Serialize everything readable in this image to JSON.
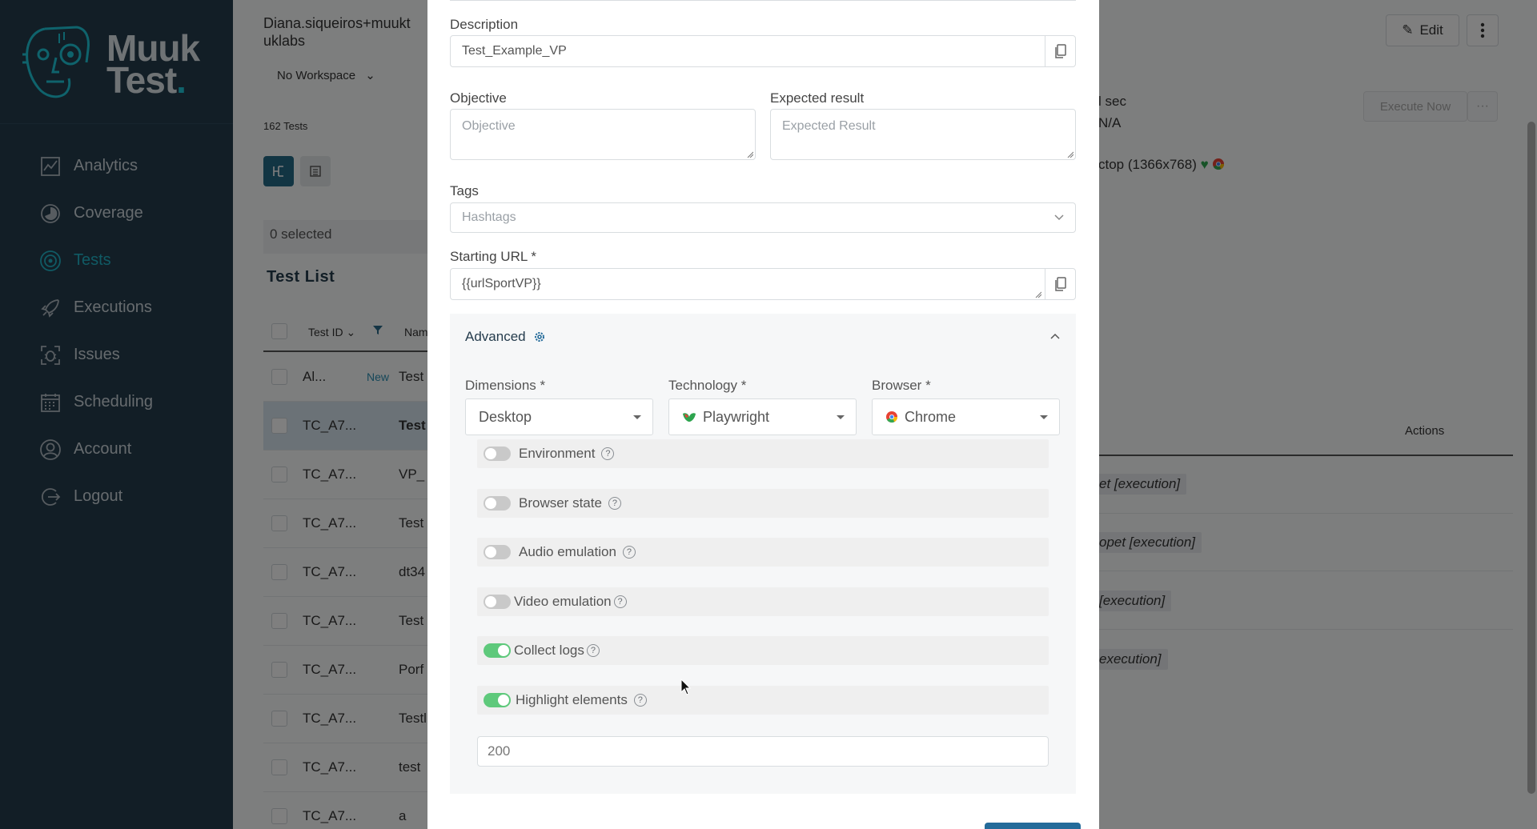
{
  "sidebar": {
    "logo": {
      "line1": "Muuk",
      "line2": "Test",
      "dot": "."
    },
    "items": [
      {
        "label": "Analytics",
        "icon": "analytics-icon",
        "active": false
      },
      {
        "label": "Coverage",
        "icon": "coverage-icon",
        "active": false
      },
      {
        "label": "Tests",
        "icon": "tests-icon",
        "active": true
      },
      {
        "label": "Executions",
        "icon": "rocket-icon",
        "active": false
      },
      {
        "label": "Issues",
        "icon": "bug-icon",
        "active": false
      },
      {
        "label": "Scheduling",
        "icon": "calendar-icon",
        "active": false
      },
      {
        "label": "Account",
        "icon": "user-icon",
        "active": false
      },
      {
        "label": "Logout",
        "icon": "logout-icon",
        "active": false
      }
    ]
  },
  "main": {
    "user_line1": "Diana.siqueiros+muukt",
    "user_line2": "uklabs",
    "workspace": "No Workspace",
    "tests_count": "162",
    "tests_label": "Tests",
    "selected": "0 selected",
    "list_title": "Test List",
    "col_test_id": "Test ID",
    "col_name": "Nam",
    "rows": [
      {
        "id": "Al...",
        "badge": "New",
        "name": "Test"
      },
      {
        "id": "TC_A7...",
        "name": "Test"
      },
      {
        "id": "TC_A7...",
        "name": "VP_"
      },
      {
        "id": "TC_A7...",
        "name": "Test"
      },
      {
        "id": "TC_A7...",
        "name": "dt34"
      },
      {
        "id": "TC_A7...",
        "name": "Test"
      },
      {
        "id": "TC_A7...",
        "name": "Porf"
      },
      {
        "id": "TC_A7...",
        "name": "Testl"
      },
      {
        "id": "TC_A7...",
        "name": "test"
      },
      {
        "id": "TC_A7...",
        "name": "a"
      }
    ],
    "edit_label": "Edit",
    "execute_now": "Execute Now",
    "execute_more": "···",
    "detail_sec": "l sec",
    "detail_na": "N/A",
    "detail_resolution": "ctop (1366x768)",
    "actions_header": "Actions",
    "exec_tags": [
      "et [execution]",
      "opet [execution]",
      "[execution]",
      "execution]"
    ]
  },
  "modal": {
    "description_label": "Description",
    "description_value": "Test_Example_VP",
    "objective_label": "Objective",
    "objective_placeholder": "Objective",
    "expected_label": "Expected result",
    "expected_placeholder": "Expected Result",
    "tags_label": "Tags",
    "tags_placeholder": "Hashtags",
    "starting_url_label": "Starting URL *",
    "starting_url_value": "{{urlSportVP}}",
    "advanced_label": "Advanced",
    "dimensions_label": "Dimensions *",
    "dimensions_value": "Desktop",
    "technology_label": "Technology *",
    "technology_value": "Playwright",
    "browser_label": "Browser *",
    "browser_value": "Chrome",
    "toggles": [
      {
        "label": "Environment",
        "on": false
      },
      {
        "label": "Browser state",
        "on": false
      },
      {
        "label": "Audio emulation",
        "on": false
      },
      {
        "label": "Video emulation",
        "on": false
      },
      {
        "label": "Collect logs",
        "on": true
      },
      {
        "label": "Highlight elements",
        "on": true
      }
    ],
    "highlight_value": "200",
    "help_glyph": "?"
  },
  "colors": {
    "sidebar_bg": "#253c4d",
    "accent": "#21b5c9",
    "toggle_on": "#5ec97b",
    "primary_button": "#246b9a"
  }
}
